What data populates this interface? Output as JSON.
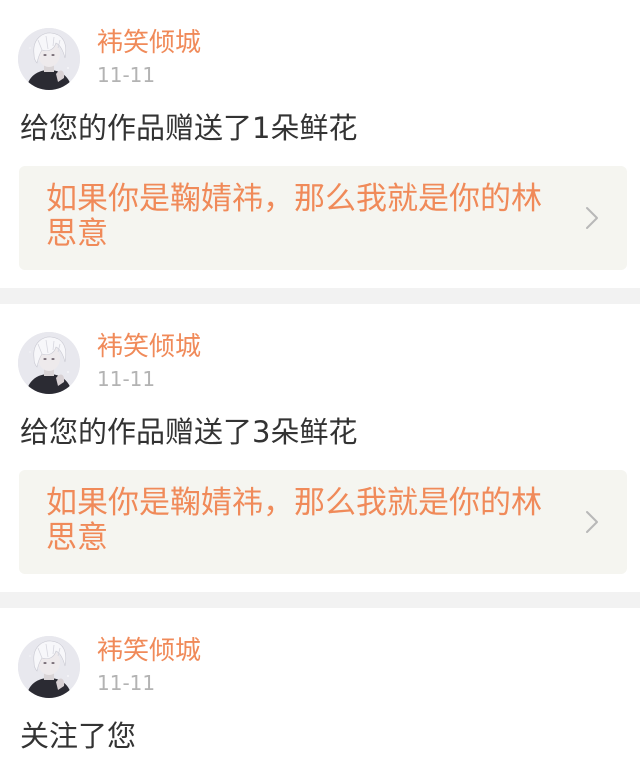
{
  "notifications": [
    {
      "username": "袆笑倾城",
      "date": "11-11",
      "message": "给您的作品赠送了1朵鲜花",
      "work_title": "如果你是鞠婧祎，那么我就是你的林思意"
    },
    {
      "username": "袆笑倾城",
      "date": "11-11",
      "message": "给您的作品赠送了3朵鲜花",
      "work_title": "如果你是鞠婧祎，那么我就是你的林思意"
    },
    {
      "username": "袆笑倾城",
      "date": "11-11",
      "message": "关注了您"
    }
  ],
  "icons": {
    "work_link": "chevron-right-icon"
  },
  "colors": {
    "accent": "#f08a59",
    "timestamp": "#b3b3b3",
    "body_text": "#333333",
    "card_bg": "#ffffff",
    "feed_bg": "#f2f2f2",
    "link_bg": "#f5f5f0"
  }
}
